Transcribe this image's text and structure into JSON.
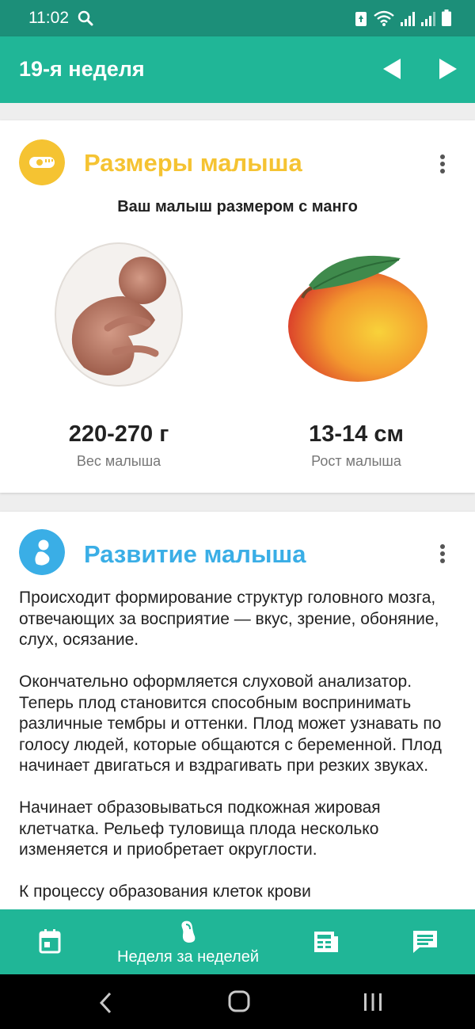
{
  "status_bar": {
    "time": "11:02",
    "icons": [
      "search-icon",
      "saver-icon",
      "wifi-icon",
      "signal-icon",
      "signal-icon",
      "battery-icon"
    ]
  },
  "app_bar": {
    "title": "19-я неделя",
    "prev_icon": "chevron-left-icon",
    "next_icon": "chevron-right-icon"
  },
  "size_card": {
    "title": "Размеры малыша",
    "icon": "measuring-tape-icon",
    "subtitle": "Ваш малыш размером с манго",
    "weight_value": "220-270 г",
    "weight_label": "Вес малыша",
    "height_value": "13-14 см",
    "height_label": "Рост малыша"
  },
  "development_card": {
    "title": "Развитие малыша",
    "icon": "baby-icon",
    "paragraphs": [
      "Происходит формирование структур головного мозга, отвечающих за восприятие — вкус, зрение, обоняние, слух, осязание.",
      "Окончательно оформляется слуховой анализатор. Теперь плод становится способным воспринимать различные тембры и оттенки. Плод может узнавать по голосу людей, которые общаются с беременной. Плод начинает двигаться и вздрагивать при резких звуках.",
      "Начинает образовываться подкожная жировая клетчатка. Рельеф туловища плода несколько изменяется и приобретает округлости.",
      "К процессу образования клеток крови"
    ]
  },
  "bottom_nav": {
    "items": [
      {
        "icon": "calendar-icon"
      },
      {
        "icon": "foot-icon",
        "label": "Неделя за неделей"
      },
      {
        "icon": "newspaper-icon"
      },
      {
        "icon": "chat-icon"
      }
    ]
  },
  "colors": {
    "status_bar": "#1c8f79",
    "primary": "#20b697",
    "size_accent": "#f5c332",
    "development_accent": "#3aaee6"
  }
}
